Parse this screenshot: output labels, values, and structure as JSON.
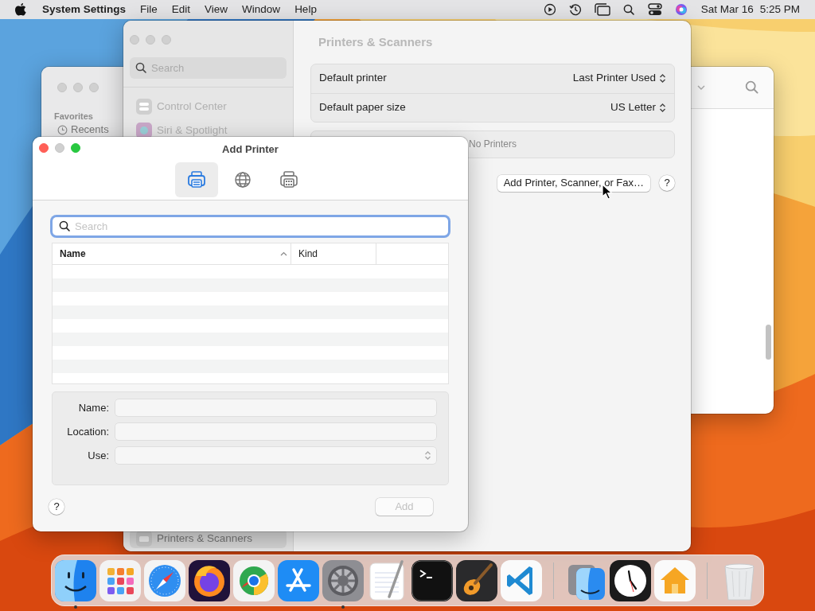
{
  "menu_bar": {
    "app_name": "System Settings",
    "menus": [
      "File",
      "Edit",
      "View",
      "Window",
      "Help"
    ],
    "date": "Sat Mar 16",
    "time": "5:25 PM"
  },
  "finder_window": {
    "sidebar_heading": "Favorites",
    "sidebar_items": [
      "Recents"
    ]
  },
  "settings_window": {
    "search": {
      "placeholder": "Search"
    },
    "sidebar_items": [
      {
        "label": "Control Center",
        "kind": "switches",
        "selected": false
      },
      {
        "label": "Siri & Spotlight",
        "kind": "orb",
        "selected": false
      },
      {
        "label": "Printers & Scanners",
        "kind": "printer",
        "selected": true
      }
    ],
    "title": "Printers & Scanners",
    "settings": [
      {
        "label": "Default printer",
        "value": "Last Printer Used"
      },
      {
        "label": "Default paper size",
        "value": "US Letter"
      }
    ],
    "printers_empty": "No Printers",
    "add_button": "Add Printer, Scanner, or Fax…",
    "help_button": "?"
  },
  "add_printer": {
    "title": "Add Printer",
    "toolbar": [
      {
        "kind": "default",
        "selected": true
      },
      {
        "kind": "ip",
        "selected": false
      },
      {
        "kind": "windows",
        "selected": false
      }
    ],
    "search": {
      "placeholder": "Search"
    },
    "columns": [
      {
        "label": "Name",
        "sorted": true
      },
      {
        "label": "Kind",
        "sorted": false
      }
    ],
    "fields": [
      {
        "label": "Name:",
        "kind": "text"
      },
      {
        "label": "Location:",
        "kind": "text"
      },
      {
        "label": "Use:",
        "kind": "popup"
      }
    ],
    "help_button": "?",
    "add_button": {
      "label": "Add",
      "disabled": true
    }
  },
  "dock": {
    "sections": [
      {
        "items": [
          {
            "kind": "finder",
            "running": true
          },
          {
            "kind": "launchpad",
            "running": false
          },
          {
            "kind": "safari",
            "running": false
          },
          {
            "kind": "firefox",
            "running": false
          },
          {
            "kind": "chrome",
            "running": false
          },
          {
            "kind": "appstore",
            "running": false
          },
          {
            "kind": "settings",
            "running": true
          },
          {
            "kind": "textedit",
            "running": false
          },
          {
            "kind": "terminal",
            "running": false
          },
          {
            "kind": "garageband",
            "running": false
          },
          {
            "kind": "vscode",
            "running": false
          }
        ]
      },
      {
        "items": [
          {
            "kind": "folder",
            "running": false
          },
          {
            "kind": "clock",
            "running": false
          },
          {
            "kind": "home",
            "running": false
          }
        ]
      },
      {
        "items": [
          {
            "kind": "trash",
            "running": false
          }
        ]
      }
    ]
  }
}
